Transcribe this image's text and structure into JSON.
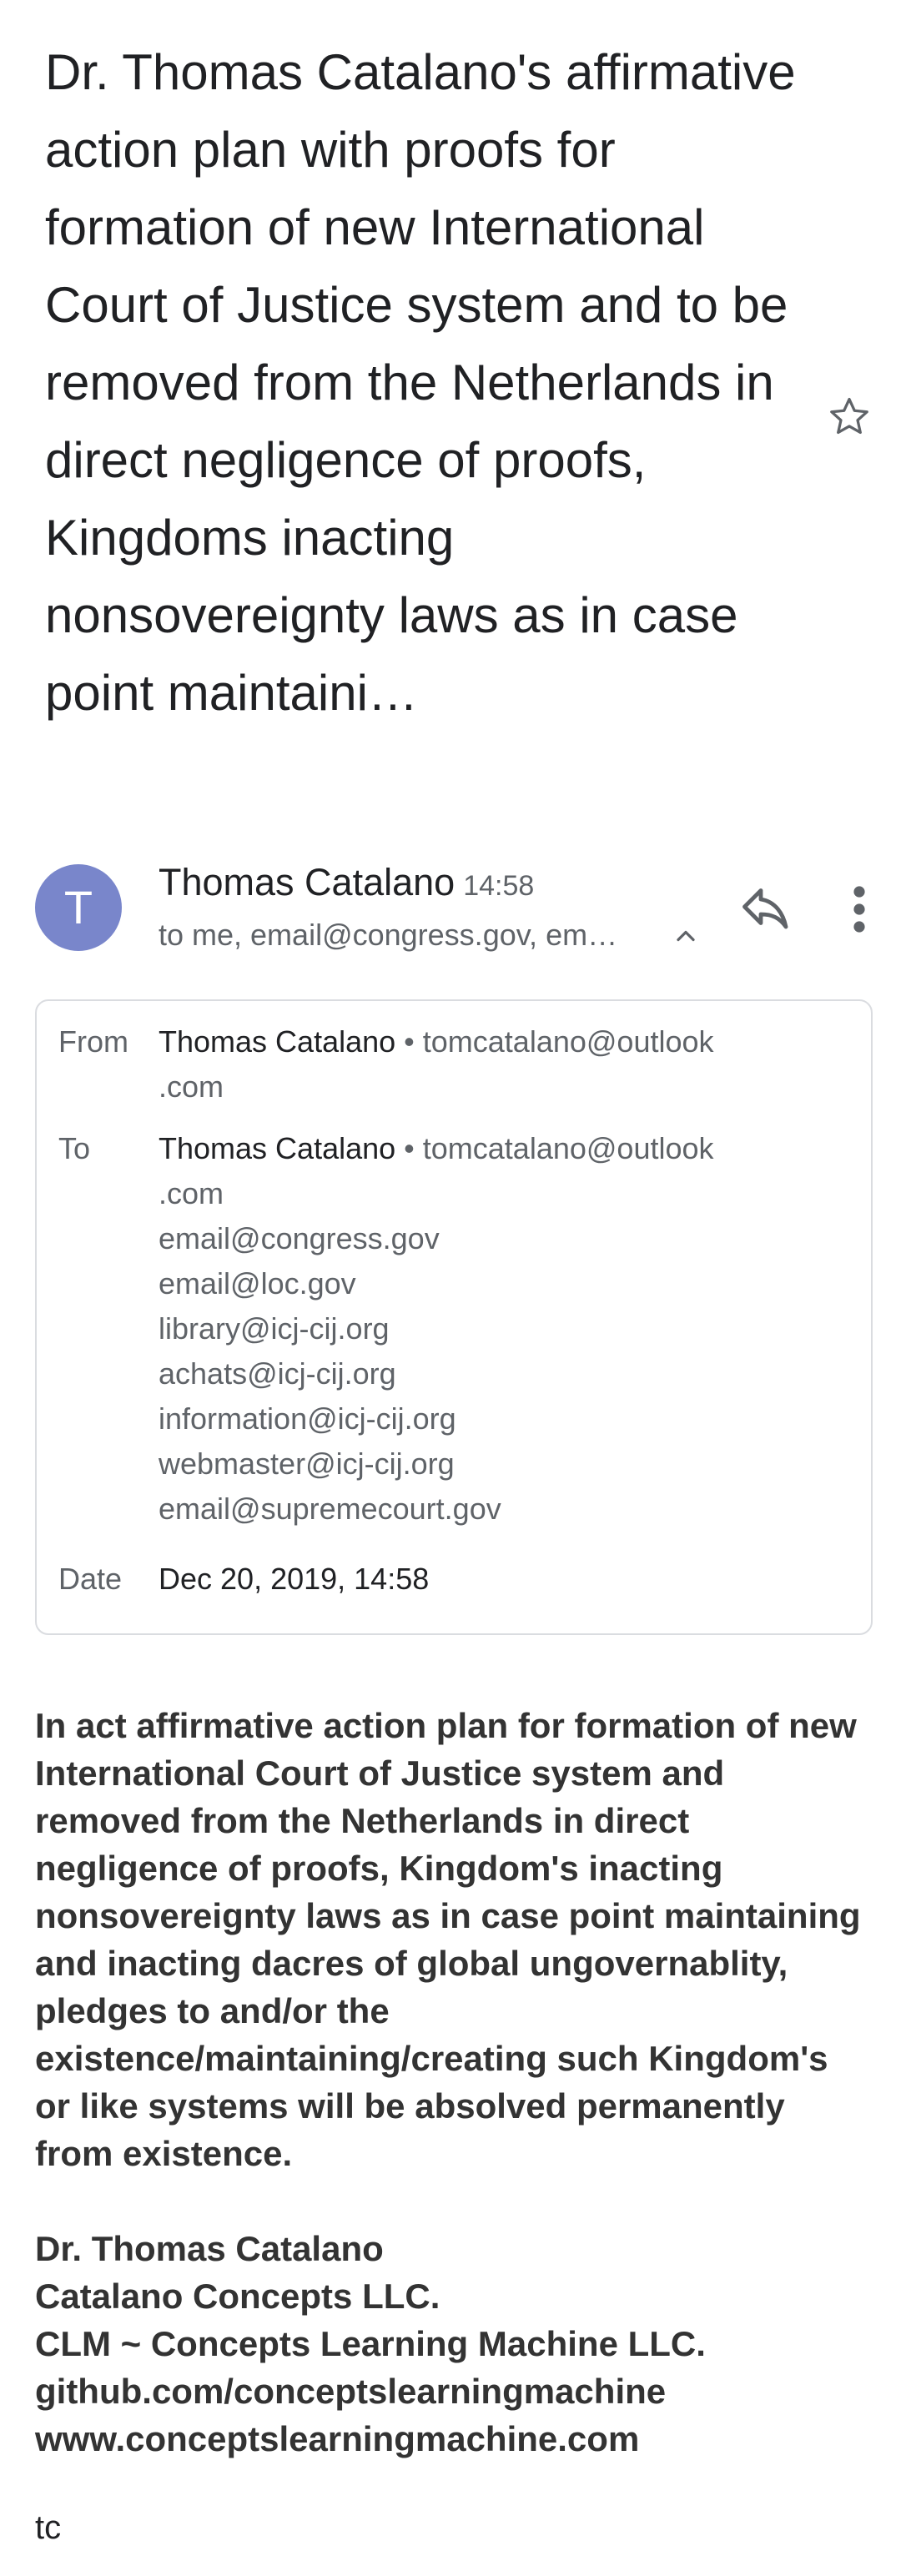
{
  "email": {
    "subject": "Dr. Thomas Catalano's affirmative action plan with proofs for formation of new International Court of Justice system and to be removed from the Netherlands in direct negligence of proofs, Kingdoms inacting nonsovereignty laws as in case point maintaini…",
    "sender": {
      "avatar_letter": "T",
      "name": "Thomas Catalano",
      "time": "14:58",
      "recipients_summary": "to me, email@congress.gov, em…"
    },
    "details": {
      "from_label": "From",
      "from_name": "Thomas Catalano",
      "from_separator": " • ",
      "from_email_line1": "tomcatalano@outlook",
      "from_email_line2": ".com",
      "to_label": "To",
      "to_name": "Thomas Catalano",
      "to_separator": " • ",
      "to_email_line1": "tomcatalano@outlook",
      "to_email_line2": ".com",
      "to_list": [
        "email@congress.gov",
        "email@loc.gov",
        "library@icj-cij.org",
        "achats@icj-cij.org",
        "information@icj-cij.org",
        "webmaster@icj-cij.org",
        "email@supremecourt.gov"
      ],
      "date_label": "Date",
      "date_value": "Dec 20, 2019, 14:58"
    },
    "body": {
      "paragraph": "In act affirmative action plan for formation of new International Court of Justice system and removed from the Netherlands in direct negligence of proofs, Kingdom's inacting nonsovereignty laws as in case point maintaining and inacting dacres of global ungovernablity, pledges to and/or the existence/maintaining/creating such Kingdom's or like systems will be absolved permanently from existence.",
      "signature": [
        "Dr. Thomas Catalano",
        "Catalano Concepts LLC.",
        "CLM ~ Concepts Learning Machine LLC.",
        "github.com/conceptslearningmachine",
        "www.conceptslearningmachine.com"
      ],
      "closing": "tc"
    }
  },
  "icons": {
    "star": "star-outline-icon",
    "reply": "reply-icon",
    "more": "more-vert-icon",
    "chevron": "chevron-up-icon"
  },
  "colors": {
    "avatar_bg": "#7986cb",
    "text_primary": "#202124",
    "text_secondary": "#5f6368",
    "card_border": "#dadce0",
    "body_text": "#333333"
  }
}
